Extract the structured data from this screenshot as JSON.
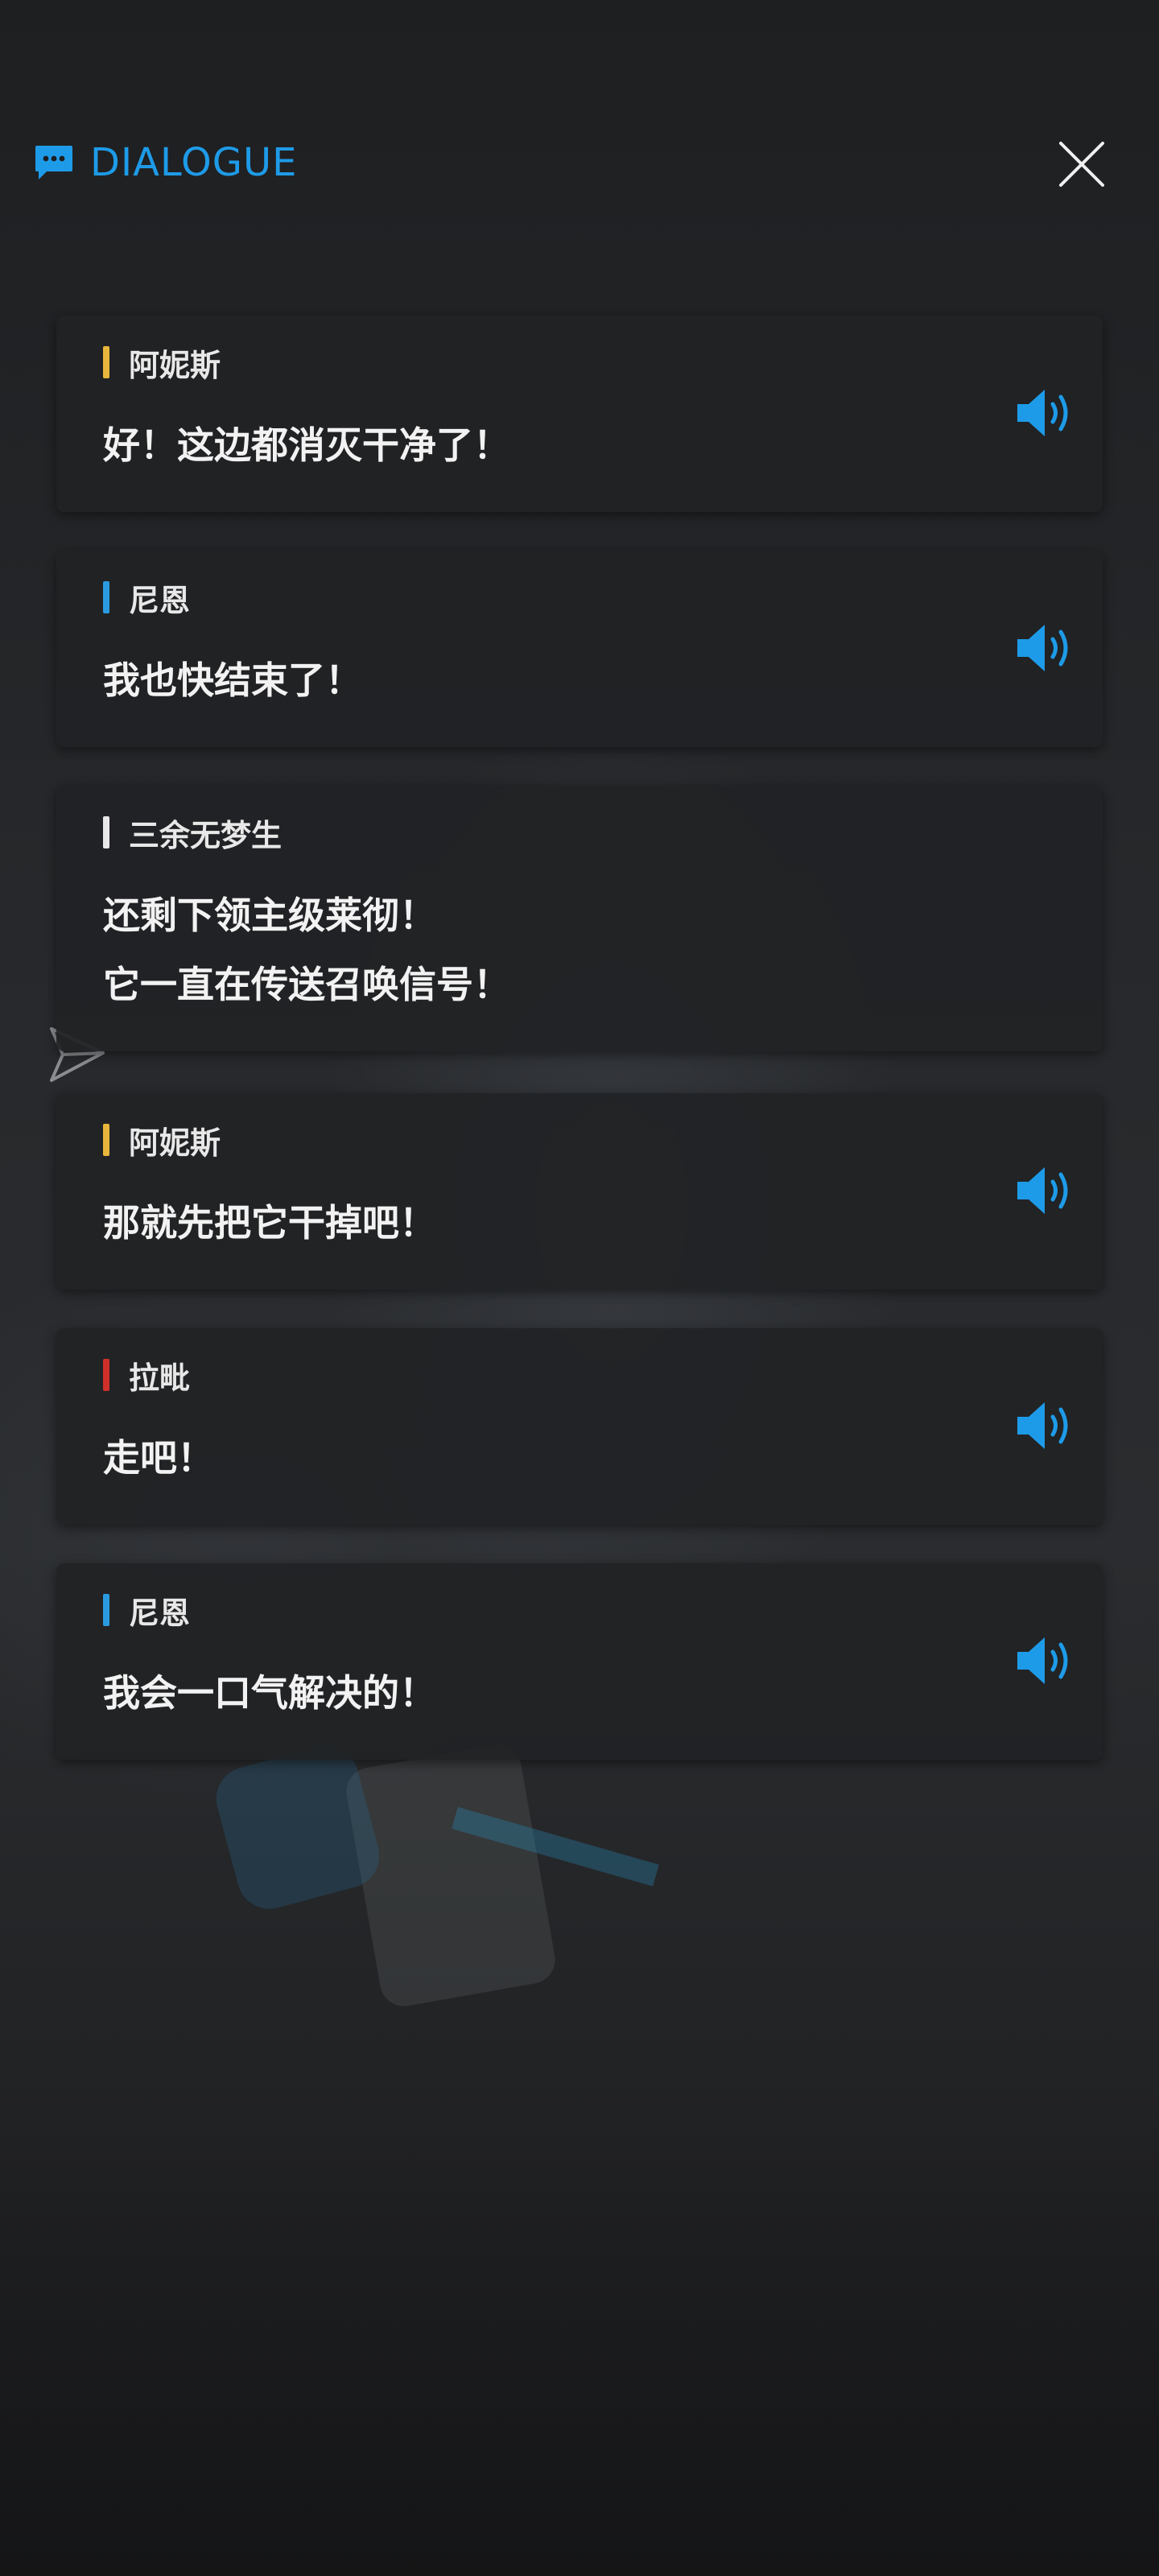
{
  "header": {
    "title": "DIALOGUE",
    "accent_color": "#1e9be8"
  },
  "icons": {
    "header": "chat-bubble-icon",
    "close": "close-icon",
    "voice": "speaker-volume-icon",
    "side": "send-arrow-icon"
  },
  "dialogue": [
    {
      "speaker": "阿妮斯",
      "speaker_color": "#e8b63c",
      "lines": [
        "好！这边都消灭干净了！"
      ],
      "has_voice": true
    },
    {
      "speaker": "尼恩",
      "speaker_color": "#2a9be0",
      "lines": [
        "我也快结束了！"
      ],
      "has_voice": true
    },
    {
      "speaker": "三余无梦生",
      "speaker_color": "#e8e8e8",
      "lines": [
        "还剩下领主级莱彻！",
        "它一直在传送召唤信号！"
      ],
      "has_voice": false
    },
    {
      "speaker": "阿妮斯",
      "speaker_color": "#e8b63c",
      "lines": [
        "那就先把它干掉吧！"
      ],
      "has_voice": true
    },
    {
      "speaker": "拉毗",
      "speaker_color": "#d0302a",
      "lines": [
        "走吧！"
      ],
      "has_voice": true
    },
    {
      "speaker": "尼恩",
      "speaker_color": "#2a9be0",
      "lines": [
        "我会一口气解决的！"
      ],
      "has_voice": true
    }
  ]
}
